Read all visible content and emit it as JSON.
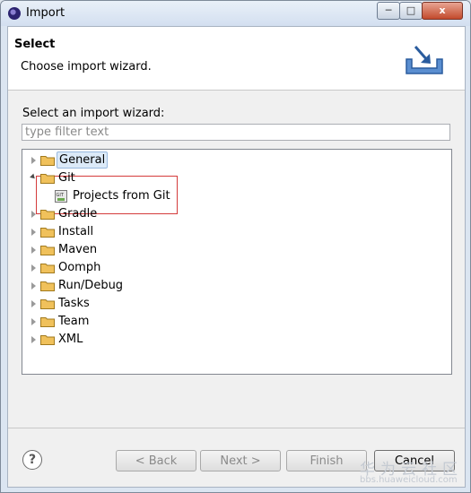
{
  "window": {
    "title": "Import",
    "min_glyph": "─",
    "max_glyph": "□",
    "close_glyph": "x"
  },
  "header": {
    "title": "Select",
    "description": "Choose import wizard."
  },
  "filter": {
    "label": "Select an import wizard:",
    "placeholder": "type filter text",
    "value": ""
  },
  "tree": {
    "items": [
      {
        "label": "General",
        "expanded": false,
        "selected": true
      },
      {
        "label": "Git",
        "expanded": true,
        "children": [
          {
            "label": "Projects from Git",
            "icon": "git-file-icon"
          }
        ]
      },
      {
        "label": "Gradle",
        "expanded": false
      },
      {
        "label": "Install",
        "expanded": false
      },
      {
        "label": "Maven",
        "expanded": false
      },
      {
        "label": "Oomph",
        "expanded": false
      },
      {
        "label": "Run/Debug",
        "expanded": false
      },
      {
        "label": "Tasks",
        "expanded": false
      },
      {
        "label": "Team",
        "expanded": false
      },
      {
        "label": "XML",
        "expanded": false
      }
    ]
  },
  "buttons": {
    "help": "?",
    "back": "< Back",
    "next": "Next >",
    "finish": "Finish",
    "cancel": "Cancel"
  },
  "watermark": {
    "main": "华为云社区",
    "sub": "bbs.huaweicloud.com"
  },
  "colors": {
    "highlight_border": "#d43b3b",
    "selection_bg": "#dceaf8",
    "folder": "#f0c15b"
  }
}
